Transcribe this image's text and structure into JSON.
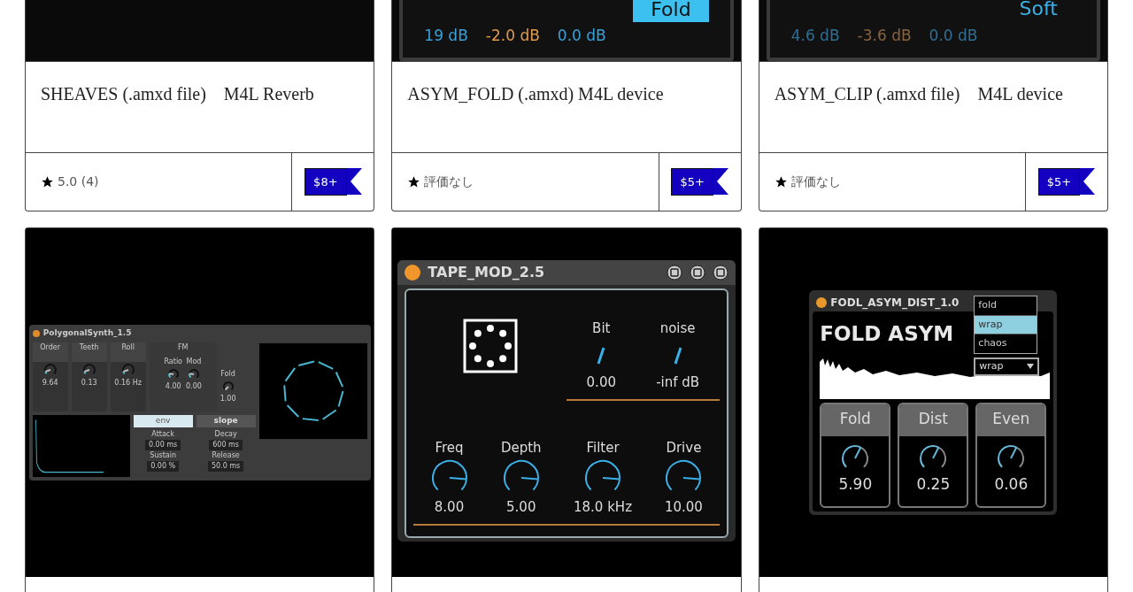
{
  "products": [
    {
      "image": {
        "kind": "blank"
      },
      "title": "SHEAVES (.amxd file)    M4L Reverb",
      "rating": "5.0 (4)",
      "price": "$8+"
    },
    {
      "image": {
        "kind": "meter",
        "readings": [
          {
            "text": "19 dB",
            "color": "#3aa0d8"
          },
          {
            "text": "-2.0 dB",
            "color": "#e09a4a"
          },
          {
            "text": "0.0 dB",
            "color": "#3aa0d8"
          }
        ],
        "button": {
          "label": "Fold",
          "selected": true
        }
      },
      "title": "ASYM_FOLD (.amxd) M4L device",
      "rating": "評価なし",
      "price": "$5+"
    },
    {
      "image": {
        "kind": "meter",
        "readings": [
          {
            "text": "4.6 dB",
            "color": "#2f6f94"
          },
          {
            "text": "-3.6 dB",
            "color": "#8a6240"
          },
          {
            "text": "0.0 dB",
            "color": "#2f6f94"
          }
        ],
        "button": {
          "label": "Soft",
          "selected": false
        }
      },
      "title": "ASYM_CLIP (.amxd file)    M4L device",
      "rating": "評価なし",
      "price": "$5+"
    },
    {
      "image": {
        "kind": "polysynth",
        "title": "PolygonalSynth_1.5",
        "knobs": [
          {
            "label": "Order",
            "value": "9.64"
          },
          {
            "label": "Teeth",
            "value": "0.13"
          },
          {
            "label": "Roll",
            "value": "0.16 Hz"
          }
        ],
        "fm": {
          "label": "FM",
          "knobs": [
            {
              "label": "Ratio",
              "value": "4.00"
            },
            {
              "label": "Mod",
              "value": "0.00"
            }
          ]
        },
        "fold": {
          "label": "Fold",
          "value": "1.00"
        },
        "tabs": [
          {
            "label": "env",
            "selected": true
          },
          {
            "label": "slope",
            "selected": false
          }
        ],
        "params": [
          {
            "label": "Attack",
            "value": "0.00 ms"
          },
          {
            "label": "Decay",
            "value": "600 ms"
          },
          {
            "label": "Sustain",
            "value": "0.00 %"
          },
          {
            "label": "Release",
            "value": "50.0 ms"
          }
        ]
      }
    },
    {
      "image": {
        "kind": "tapemod",
        "title": "TAPE_MOD_2.5",
        "sliders": [
          {
            "label": "Bit",
            "value": "0.00"
          },
          {
            "label": "noise",
            "value": "-inf dB"
          }
        ],
        "knobs": [
          {
            "label": "Freq",
            "value": "8.00"
          },
          {
            "label": "Depth",
            "value": "5.00"
          },
          {
            "label": "Filter",
            "value": "18.0 kHz"
          },
          {
            "label": "Drive",
            "value": "10.00"
          }
        ]
      }
    },
    {
      "image": {
        "kind": "foldasym",
        "title": "FODL_ASYM_DIST_1.0",
        "heading": "FOLD ASYM",
        "menu": [
          {
            "label": "fold",
            "selected": false
          },
          {
            "label": "wrap",
            "selected": true
          },
          {
            "label": "chaos",
            "selected": false
          }
        ],
        "dropdown": "wrap",
        "knobs": [
          {
            "label": "Fold",
            "value": "5.90"
          },
          {
            "label": "Dist",
            "value": "0.25"
          },
          {
            "label": "Even",
            "value": "0.06"
          }
        ]
      }
    }
  ]
}
